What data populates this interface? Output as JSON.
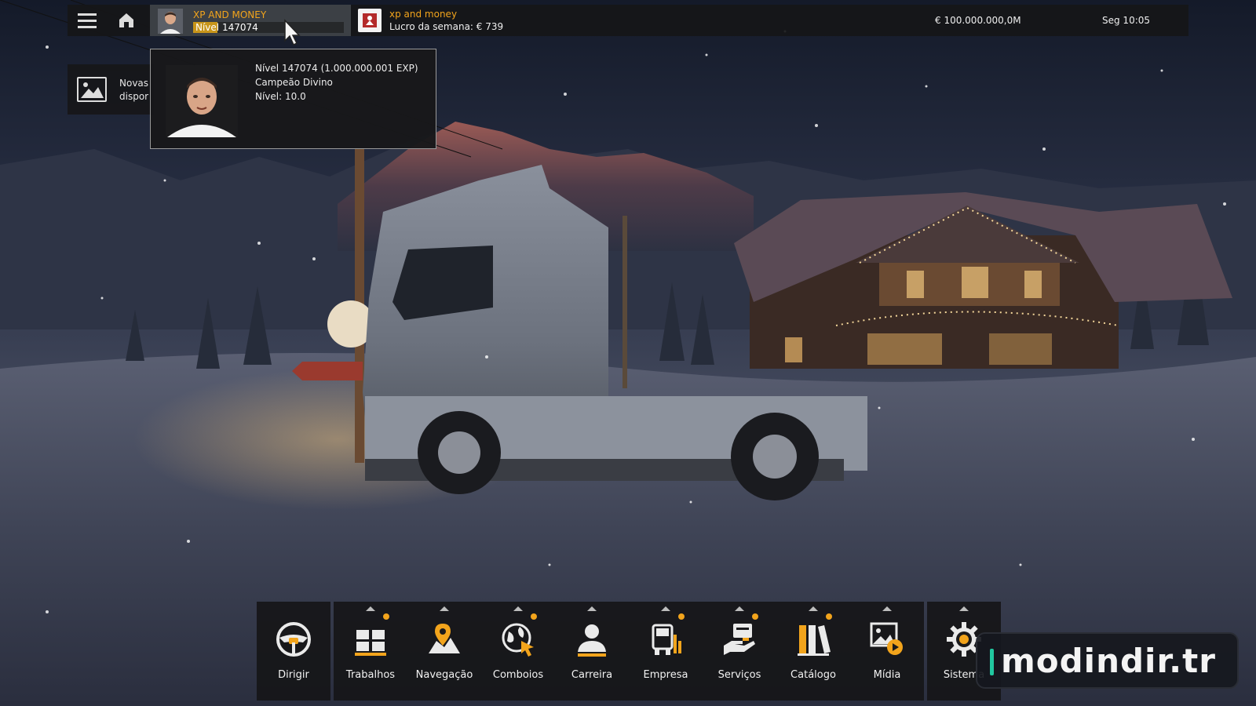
{
  "topbar": {
    "menu_icon": "hamburger-menu-icon",
    "home_icon": "home-icon",
    "profile": {
      "name": "XP AND MONEY",
      "level_label": "Nível 147074",
      "level_progress": 0.16
    },
    "company": {
      "logo_icon": "company-logo-icon",
      "name": "xp and money",
      "weekly_profit": "Lucro da semana: € 739"
    },
    "money": "€ 100.000.000,0M",
    "clock": "Seg 10:05"
  },
  "news": {
    "icon": "image-icon",
    "line1": "Novas",
    "line2": "dispor"
  },
  "tooltip": {
    "level_exp": "Nível 147074 (1.000.000.001 EXP)",
    "title": "Campeão Divino",
    "skill_level": "Nível: 10.0"
  },
  "dock": {
    "items": [
      {
        "label": "Dirigir",
        "icon": "steering-wheel-icon",
        "caret": false,
        "dot": false
      },
      {
        "label": "Trabalhos",
        "icon": "cargo-boxes-icon",
        "caret": true,
        "dot": true
      },
      {
        "label": "Navegação",
        "icon": "map-pin-icon",
        "caret": true,
        "dot": false
      },
      {
        "label": "Comboios",
        "icon": "globe-convoy-icon",
        "caret": true,
        "dot": true
      },
      {
        "label": "Carreira",
        "icon": "person-icon",
        "caret": true,
        "dot": false
      },
      {
        "label": "Empresa",
        "icon": "truck-company-icon",
        "caret": true,
        "dot": true
      },
      {
        "label": "Serviços",
        "icon": "service-hand-icon",
        "caret": true,
        "dot": true
      },
      {
        "label": "Catálogo",
        "icon": "books-catalog-icon",
        "caret": true,
        "dot": true
      },
      {
        "label": "Mídia",
        "icon": "media-play-icon",
        "caret": true,
        "dot": false
      },
      {
        "label": "Sistema",
        "icon": "gear-icon",
        "caret": true,
        "dot": false
      }
    ]
  },
  "watermark": {
    "text": "modindir.tr"
  },
  "colors": {
    "accent": "#f2a41c",
    "panel": "#161618",
    "watermark_bar": "#21c7a0"
  }
}
